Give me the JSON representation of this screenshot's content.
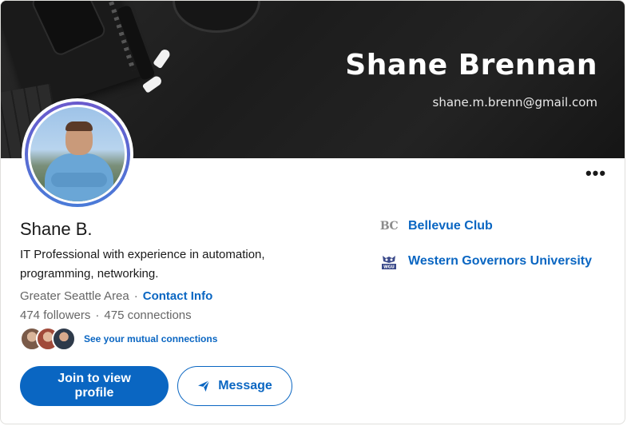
{
  "cover": {
    "name": "Shane Brennan",
    "email": "shane.m.brenn@gmail.com"
  },
  "profile": {
    "name": "Shane B.",
    "headline": "IT Professional with experience in automation, programming, networking.",
    "location": "Greater Seattle Area",
    "separator": "·",
    "contact_info_label": "Contact Info",
    "followers": "474 followers",
    "connections": "475 connections",
    "more_label": "•••"
  },
  "mutual": {
    "link_text": "See your mutual connections"
  },
  "actions": {
    "primary_label": "Join to view profile",
    "message_label": "Message"
  },
  "organizations": [
    {
      "logo_text": "BC",
      "name": "Bellevue Club"
    },
    {
      "logo_text": "WGU",
      "name": "Western Governors University"
    }
  ],
  "colors": {
    "accent": "#0a66c2",
    "muted_text": "#666666",
    "body_text": "#191919"
  },
  "icons": {
    "more": "ellipsis-icon",
    "message": "send-icon",
    "wgu": "owl-icon"
  }
}
